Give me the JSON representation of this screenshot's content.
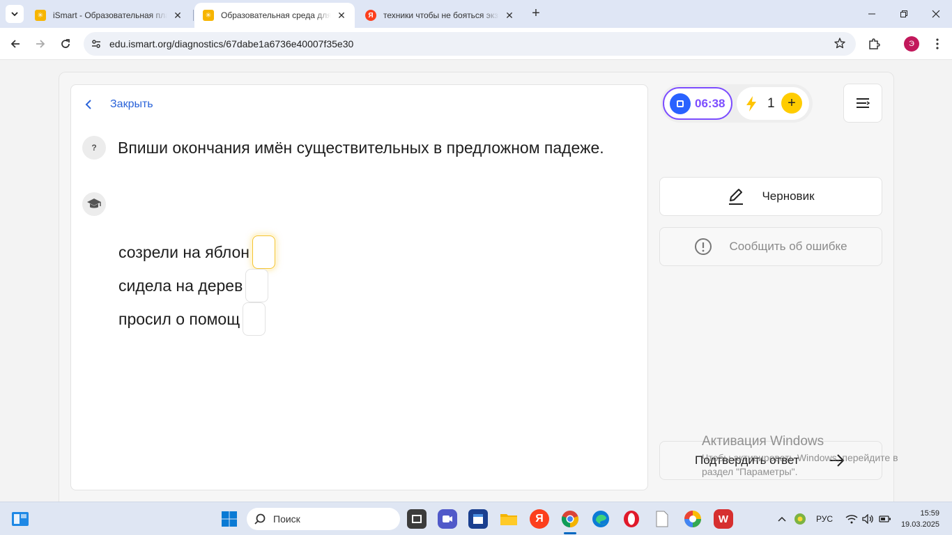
{
  "browser": {
    "tabs": [
      {
        "title": "iSmart - Образовательная платформа",
        "favicon": "ismart-icon",
        "active": false
      },
      {
        "title": "Образовательная среда для самостоятельной работы",
        "favicon": "ismart-icon",
        "active": true
      },
      {
        "title": "техники чтобы не бояться экзамена",
        "favicon": "yandex-icon",
        "active": false
      }
    ],
    "close_tab_glyph": "✕",
    "new_tab_glyph": "+",
    "url": "edu.ismart.org/diagnostics/67dabe1a6736e40007f35e30",
    "profile_initial": "Э"
  },
  "task": {
    "close_label": "Закрыть",
    "help_mark": "?",
    "question": "Впиши окончания имён существительных в предложном падеже.",
    "exercises": [
      {
        "text": "созрели на яблон",
        "answer": "",
        "focused": true
      },
      {
        "text": "сидела на дерев",
        "answer": "",
        "focused": false
      },
      {
        "text": "просил о помощ",
        "answer": "",
        "focused": false
      }
    ]
  },
  "sidebar": {
    "timer": "06:38",
    "energy_count": "1",
    "energy_add": "+",
    "draft_label": "Черновик",
    "report_label": "Сообщить об ошибке",
    "confirm_label": "Подтвердить ответ"
  },
  "watermark": {
    "title": "Активация Windows",
    "text": "Чтобы активировать Windows, перейдите в раздел \"Параметры\"."
  },
  "taskbar": {
    "search_placeholder": "Поиск",
    "lang": "РУС",
    "time": "15:59",
    "date": "19.03.2025"
  },
  "colors": {
    "accent_blue": "#2a63d9",
    "timer_purple": "#7c4dff",
    "stop_blue": "#2962ff",
    "energy_yellow": "#ffcc00",
    "focus_yellow": "#f4c430"
  }
}
